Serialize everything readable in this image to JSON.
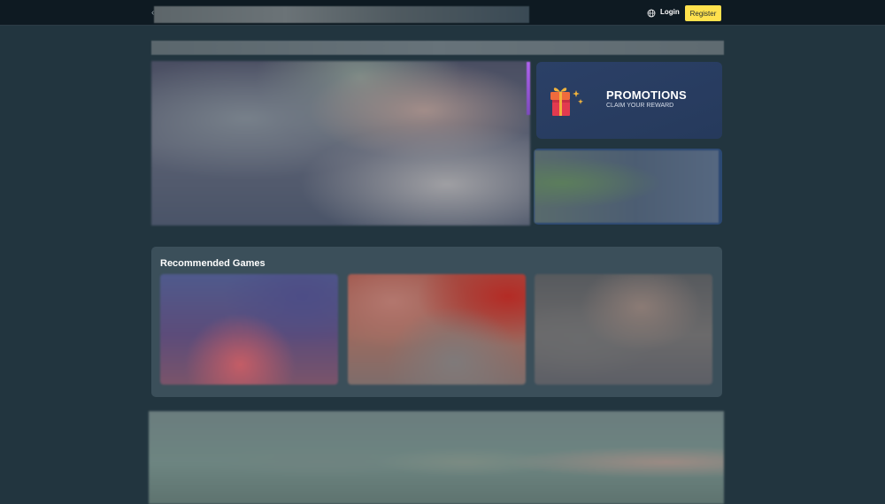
{
  "header": {
    "login_label": "Login",
    "register_label": "Register",
    "globe_icon": "globe-icon",
    "colors": {
      "register_bg": "#ffe14d",
      "topbar_bg": "#0e1a22"
    }
  },
  "promotions": {
    "title": "PROMOTIONS",
    "subtitle": "CLAIM YOUR REWARD",
    "icon": "gift-icon",
    "colors": {
      "card_bg": "#2b4067"
    }
  },
  "recommended": {
    "title": "Recommended Games",
    "games_count_visible": 3
  }
}
